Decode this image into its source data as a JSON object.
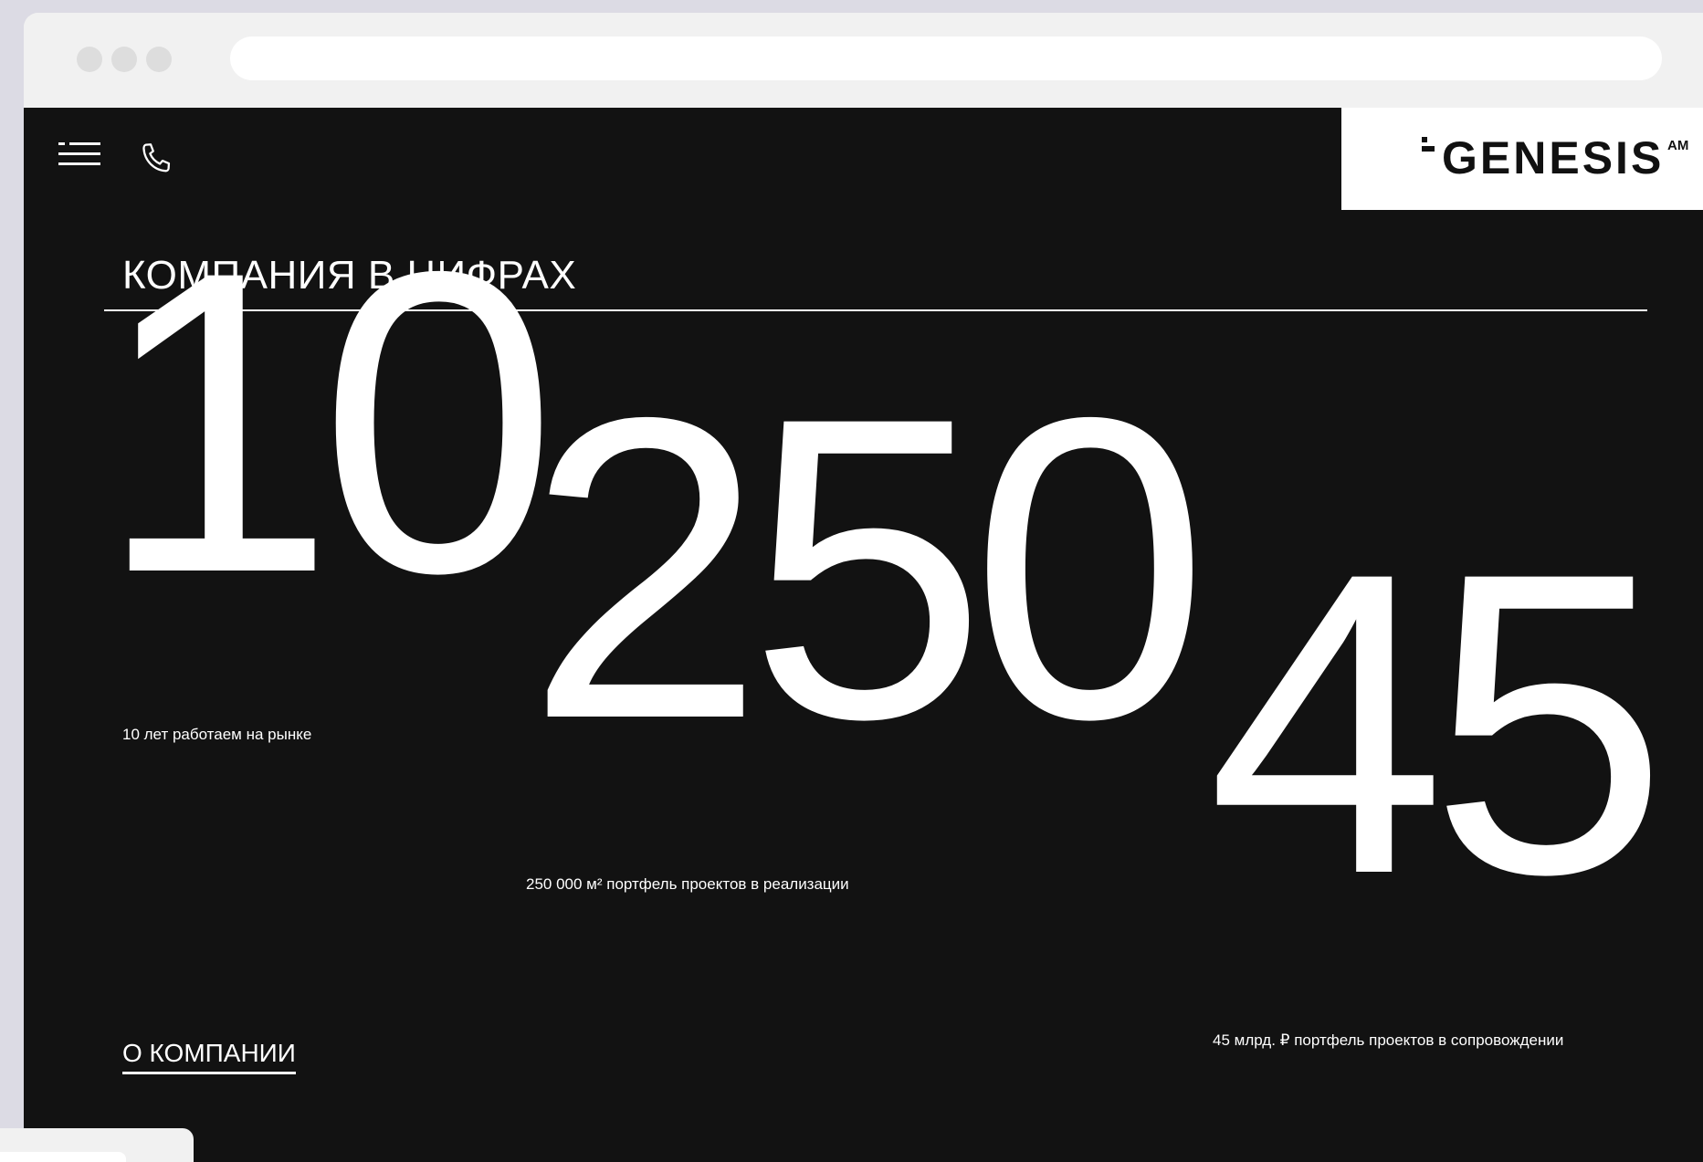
{
  "header": {
    "logo": {
      "text": "GENESIS",
      "superscript": "AM"
    }
  },
  "stats_section": {
    "title": "КОМПАНИЯ В ЦИФРАХ",
    "stats": [
      {
        "value": "10",
        "caption": "10 лет работаем на рынке"
      },
      {
        "value": "250",
        "caption": "250 000 м² портфель проектов в реализации"
      },
      {
        "value": "45",
        "caption": "45 млрд. ₽ портфель проектов в сопровождении"
      }
    ],
    "about_link": "О КОМПАНИИ"
  }
}
